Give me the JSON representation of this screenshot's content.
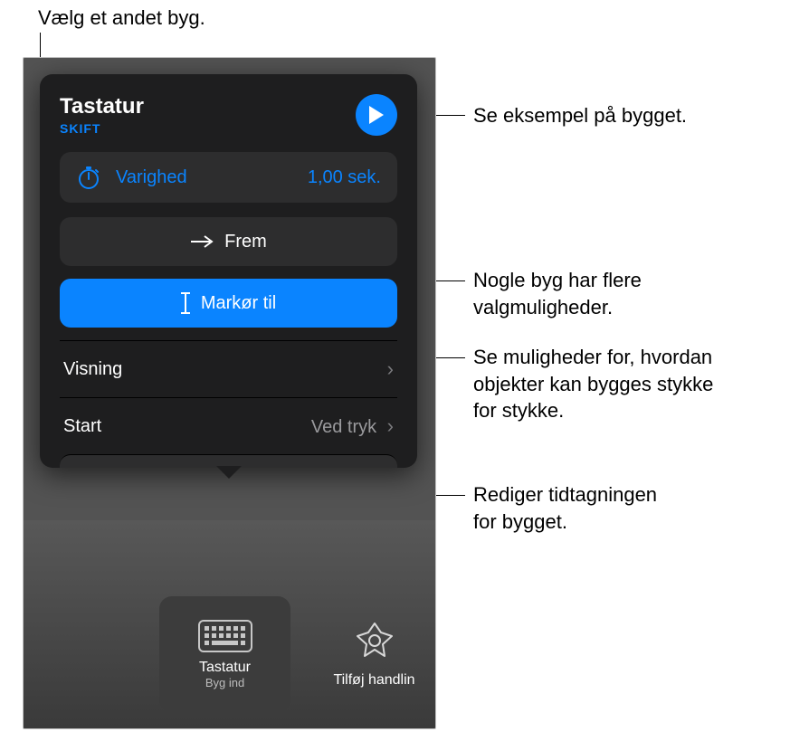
{
  "callouts": {
    "top": "Vælg et andet byg.",
    "preview": "Se eksempel på bygget.",
    "variants": "Nogle byg har flere valgmuligheder.",
    "cursor": "Se muligheder for, hvordan objekter kan bygges stykke for stykke.",
    "timing": "Rediger tidtagningen for bygget."
  },
  "popover": {
    "title": "Tastatur",
    "change": "SKIFT",
    "duration_label": "Varighed",
    "duration_value": "1,00 sek.",
    "direction": "Frem",
    "cursor_mode": "Markør til",
    "delivery_label": "Visning",
    "start_label": "Start",
    "start_value": "Ved tryk"
  },
  "tiles": {
    "selected_label": "Tastatur",
    "selected_sub": "Byg ind",
    "add_label": "Tilføj handlin"
  }
}
